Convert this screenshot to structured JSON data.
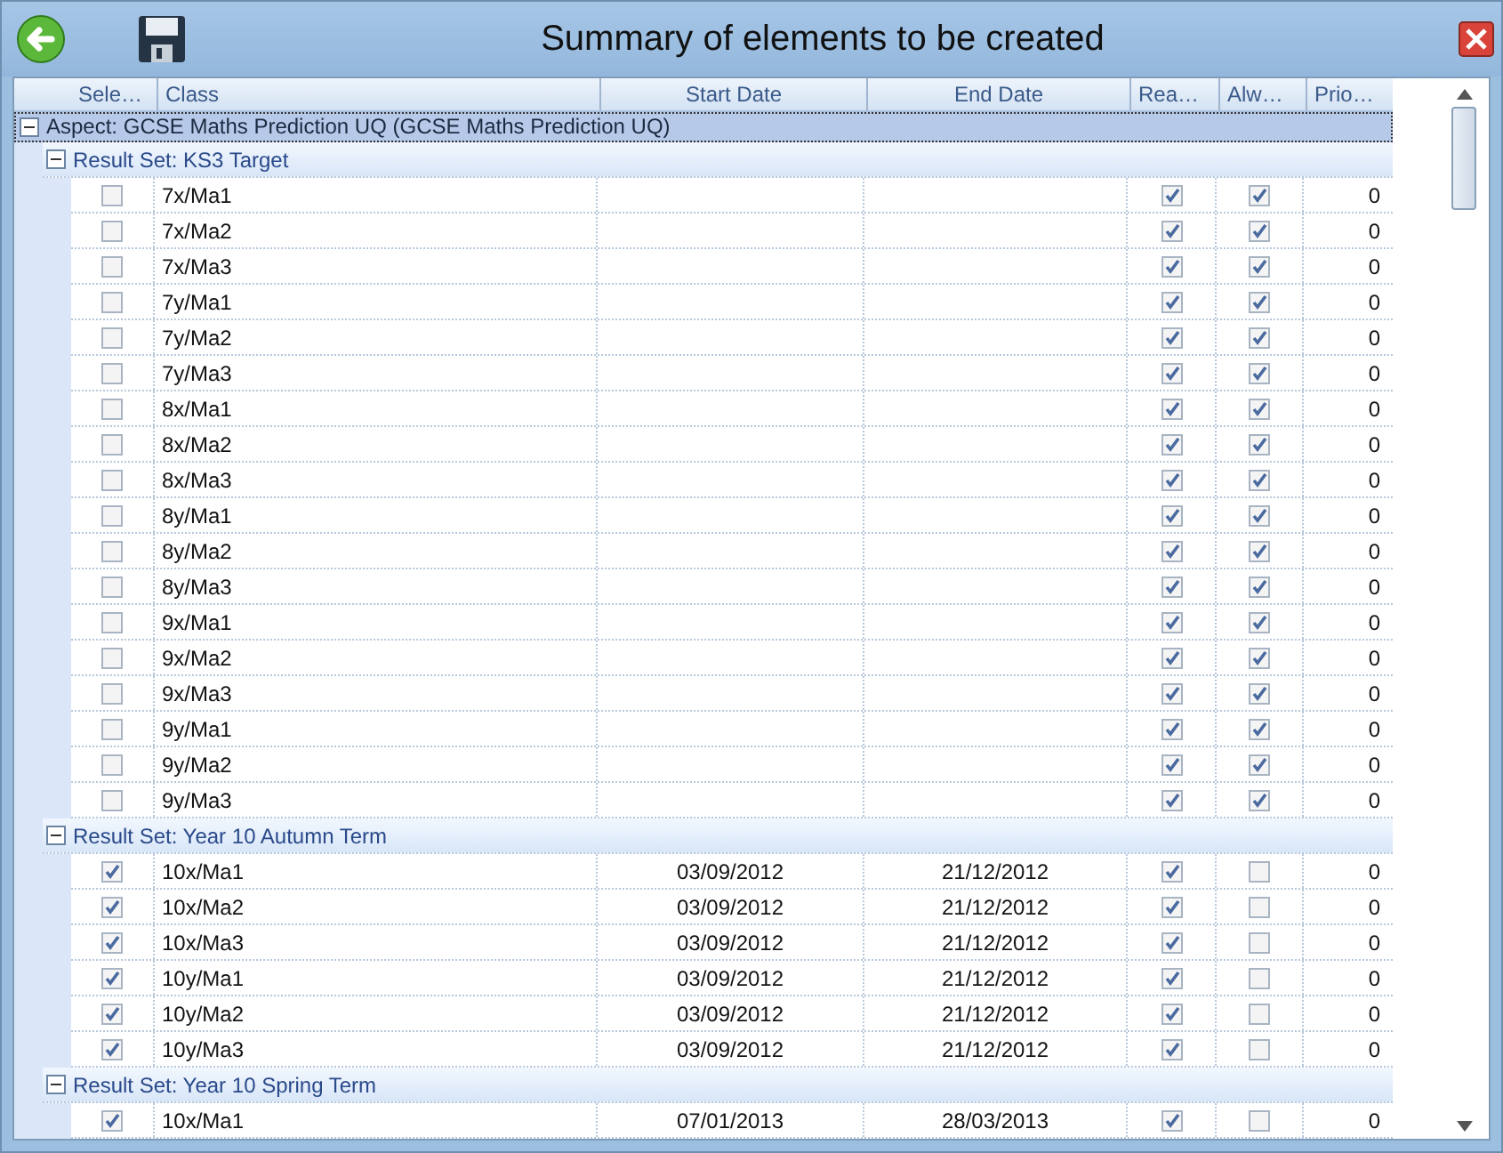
{
  "window": {
    "title": "Summary of elements to be created"
  },
  "table": {
    "columns": [
      "Sele…",
      "Class",
      "Start Date",
      "End Date",
      "Rea…",
      "Alw…",
      "Prio…"
    ],
    "aspect": {
      "label": "Aspect: GCSE Maths Prediction UQ (GCSE Maths Prediction UQ)",
      "expanded": true,
      "children": [
        {
          "label": "Result Set: KS3 Target",
          "expanded": true,
          "rows": [
            {
              "selected": false,
              "class": "7x/Ma1",
              "start": "",
              "end": "",
              "rea": true,
              "alw": true,
              "prio": "0"
            },
            {
              "selected": false,
              "class": "7x/Ma2",
              "start": "",
              "end": "",
              "rea": true,
              "alw": true,
              "prio": "0"
            },
            {
              "selected": false,
              "class": "7x/Ma3",
              "start": "",
              "end": "",
              "rea": true,
              "alw": true,
              "prio": "0"
            },
            {
              "selected": false,
              "class": "7y/Ma1",
              "start": "",
              "end": "",
              "rea": true,
              "alw": true,
              "prio": "0"
            },
            {
              "selected": false,
              "class": "7y/Ma2",
              "start": "",
              "end": "",
              "rea": true,
              "alw": true,
              "prio": "0"
            },
            {
              "selected": false,
              "class": "7y/Ma3",
              "start": "",
              "end": "",
              "rea": true,
              "alw": true,
              "prio": "0"
            },
            {
              "selected": false,
              "class": "8x/Ma1",
              "start": "",
              "end": "",
              "rea": true,
              "alw": true,
              "prio": "0"
            },
            {
              "selected": false,
              "class": "8x/Ma2",
              "start": "",
              "end": "",
              "rea": true,
              "alw": true,
              "prio": "0"
            },
            {
              "selected": false,
              "class": "8x/Ma3",
              "start": "",
              "end": "",
              "rea": true,
              "alw": true,
              "prio": "0"
            },
            {
              "selected": false,
              "class": "8y/Ma1",
              "start": "",
              "end": "",
              "rea": true,
              "alw": true,
              "prio": "0"
            },
            {
              "selected": false,
              "class": "8y/Ma2",
              "start": "",
              "end": "",
              "rea": true,
              "alw": true,
              "prio": "0"
            },
            {
              "selected": false,
              "class": "8y/Ma3",
              "start": "",
              "end": "",
              "rea": true,
              "alw": true,
              "prio": "0"
            },
            {
              "selected": false,
              "class": "9x/Ma1",
              "start": "",
              "end": "",
              "rea": true,
              "alw": true,
              "prio": "0"
            },
            {
              "selected": false,
              "class": "9x/Ma2",
              "start": "",
              "end": "",
              "rea": true,
              "alw": true,
              "prio": "0"
            },
            {
              "selected": false,
              "class": "9x/Ma3",
              "start": "",
              "end": "",
              "rea": true,
              "alw": true,
              "prio": "0"
            },
            {
              "selected": false,
              "class": "9y/Ma1",
              "start": "",
              "end": "",
              "rea": true,
              "alw": true,
              "prio": "0"
            },
            {
              "selected": false,
              "class": "9y/Ma2",
              "start": "",
              "end": "",
              "rea": true,
              "alw": true,
              "prio": "0"
            },
            {
              "selected": false,
              "class": "9y/Ma3",
              "start": "",
              "end": "",
              "rea": true,
              "alw": true,
              "prio": "0"
            }
          ]
        },
        {
          "label": "Result Set: Year 10 Autumn Term",
          "expanded": true,
          "rows": [
            {
              "selected": true,
              "class": "10x/Ma1",
              "start": "03/09/2012",
              "end": "21/12/2012",
              "rea": true,
              "alw": false,
              "prio": "0"
            },
            {
              "selected": true,
              "class": "10x/Ma2",
              "start": "03/09/2012",
              "end": "21/12/2012",
              "rea": true,
              "alw": false,
              "prio": "0"
            },
            {
              "selected": true,
              "class": "10x/Ma3",
              "start": "03/09/2012",
              "end": "21/12/2012",
              "rea": true,
              "alw": false,
              "prio": "0"
            },
            {
              "selected": true,
              "class": "10y/Ma1",
              "start": "03/09/2012",
              "end": "21/12/2012",
              "rea": true,
              "alw": false,
              "prio": "0"
            },
            {
              "selected": true,
              "class": "10y/Ma2",
              "start": "03/09/2012",
              "end": "21/12/2012",
              "rea": true,
              "alw": false,
              "prio": "0"
            },
            {
              "selected": true,
              "class": "10y/Ma3",
              "start": "03/09/2012",
              "end": "21/12/2012",
              "rea": true,
              "alw": false,
              "prio": "0"
            }
          ]
        },
        {
          "label": "Result Set: Year 10 Spring Term",
          "expanded": true,
          "rows": [
            {
              "selected": true,
              "class": "10x/Ma1",
              "start": "07/01/2013",
              "end": "28/03/2013",
              "rea": true,
              "alw": false,
              "prio": "0"
            }
          ]
        }
      ]
    }
  }
}
